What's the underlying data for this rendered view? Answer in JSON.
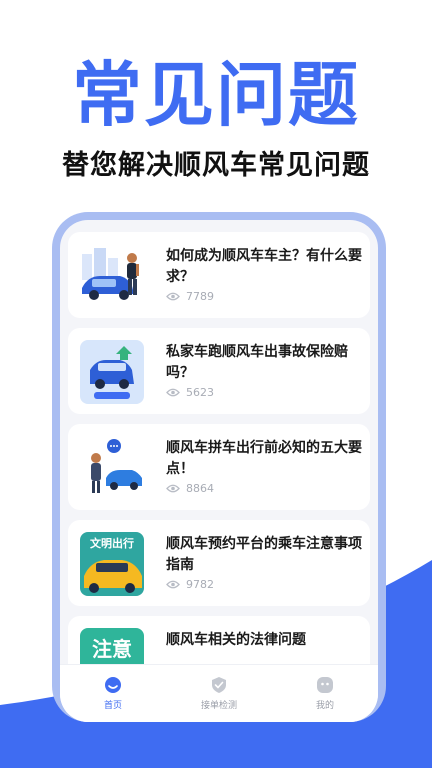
{
  "hero": {
    "title": "常见问题",
    "subtitle": "替您解决顺风车常见问题"
  },
  "articles": [
    {
      "title": "如何成为顺风车车主？有什么要求？",
      "views": "7789",
      "thumb_icon": "car-owner-illustration"
    },
    {
      "title": "私家车跑顺风车出事故保险赔吗？",
      "views": "5623",
      "thumb_icon": "car-accident-illustration"
    },
    {
      "title": "顺风车拼车出行前必知的五大要点！",
      "views": "8864",
      "thumb_icon": "carpool-tips-illustration"
    },
    {
      "title": "顺风车预约平台的乘车注意事项指南",
      "views": "9782",
      "thumb_icon": "civilized-travel-illustration",
      "thumb_text": "文明出行"
    },
    {
      "title": "顺风车相关的法律问题",
      "views": "",
      "thumb_icon": "attention-illustration",
      "thumb_text": "注意"
    }
  ],
  "tabs": [
    {
      "label": "首页",
      "icon": "home-icon",
      "active": true
    },
    {
      "label": "接单检测",
      "icon": "shield-check-icon",
      "active": false
    },
    {
      "label": "我的",
      "icon": "profile-icon",
      "active": false
    }
  ],
  "colors": {
    "accent": "#3f6cf2",
    "phone_frame": "#a9bdf2",
    "bottom_wave": "#3f6cf2"
  }
}
